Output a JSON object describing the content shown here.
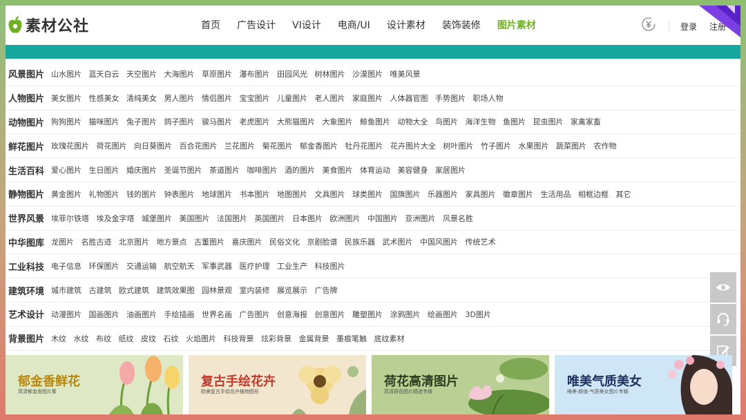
{
  "header": {
    "logo_text": "素材公社",
    "nav": [
      {
        "label": "首页",
        "active": false
      },
      {
        "label": "广告设计",
        "active": false
      },
      {
        "label": "VI设计",
        "active": false
      },
      {
        "label": "电商/UI",
        "active": false
      },
      {
        "label": "设计素材",
        "active": false
      },
      {
        "label": "装饰装修",
        "active": false
      },
      {
        "label": "图片素材",
        "active": true
      }
    ],
    "login": "登录",
    "register": "注册"
  },
  "colors": {
    "accent_green": "#6fb022",
    "teal": "#16a89e"
  },
  "categories": [
    {
      "title": "风景图片",
      "items": [
        "山水图片",
        "蓝天白云",
        "天空图片",
        "大海图片",
        "草原图片",
        "瀑布图片",
        "田园风光",
        "树林图片",
        "沙漠图片",
        "唯美风景"
      ]
    },
    {
      "title": "人物图片",
      "items": [
        "美女图片",
        "性感美女",
        "清纯美女",
        "男人图片",
        "情侣图片",
        "宝宝图片",
        "儿童图片",
        "老人图片",
        "家庭图片",
        "人体器官图",
        "手势图片",
        "职场人物"
      ]
    },
    {
      "title": "动物图片",
      "items": [
        "狗狗图片",
        "猫咪图片",
        "兔子图片",
        "鸽子图片",
        "骏马图片",
        "老虎图片",
        "大熊猫图片",
        "大象图片",
        "鲸鱼图片",
        "动物大全",
        "鸟图片",
        "海洋生物",
        "鱼图片",
        "昆虫图片",
        "家禽家畜"
      ]
    },
    {
      "title": "鲜花图片",
      "items": [
        "玫瑰花图片",
        "荷花图片",
        "向日葵图片",
        "百合花图片",
        "兰花图片",
        "菊花图片",
        "郁金香图片",
        "牡丹花图片",
        "花卉图片大全",
        "树叶图片",
        "竹子图片",
        "水果图片",
        "蔬菜图片",
        "农作物"
      ]
    },
    {
      "title": "生活百科",
      "items": [
        "爱心图片",
        "生日图片",
        "婚庆图片",
        "圣诞节图片",
        "茶道图片",
        "咖啡图片",
        "酒的图片",
        "美食图片",
        "体育运动",
        "美容健身",
        "家居图片"
      ]
    },
    {
      "title": "静物图片",
      "items": [
        "黄金图片",
        "礼物图片",
        "钱的图片",
        "钟表图片",
        "地球图片",
        "书本图片",
        "地图图片",
        "文具图片",
        "球类图片",
        "国旗图片",
        "乐器图片",
        "家具图片",
        "徽章图片",
        "生活用品",
        "相框边框",
        "其它"
      ]
    },
    {
      "title": "世界风景",
      "items": [
        "埃菲尔铁塔",
        "埃及金字塔",
        "城堡图片",
        "美国图片",
        "法国图片",
        "英国图片",
        "日本图片",
        "欧洲图片",
        "中国图片",
        "亚洲图片",
        "风景名胜"
      ]
    },
    {
      "title": "中华图库",
      "items": [
        "龙图片",
        "名胜古迹",
        "北京图片",
        "地方景点",
        "古董图片",
        "喜庆图片",
        "民俗文化",
        "京剧脸谱",
        "民族乐器",
        "武术图片",
        "中国风图片",
        "传统艺术"
      ]
    },
    {
      "title": "工业科技",
      "items": [
        "电子信息",
        "环保图片",
        "交通运输",
        "航空航天",
        "军事武器",
        "医疗护理",
        "工业生产",
        "科技图片"
      ]
    },
    {
      "title": "建筑环境",
      "items": [
        "城市建筑",
        "古建筑",
        "欧式建筑",
        "建筑效果图",
        "园林景观",
        "室内装修",
        "展览展示",
        "广告牌"
      ]
    },
    {
      "title": "艺术设计",
      "items": [
        "动漫图片",
        "国画图片",
        "油画图片",
        "手绘插画",
        "世界名画",
        "广告图片",
        "创意海报",
        "创意图片",
        "雕塑图片",
        "涂鸦图片",
        "绘画图片",
        "3D图片"
      ]
    },
    {
      "title": "背景图片",
      "items": [
        "木纹",
        "水纹",
        "布纹",
        "纸纹",
        "皮纹",
        "石纹",
        "火焰图片",
        "科技背景",
        "炫彩背景",
        "金属背景",
        "墨痕笔触",
        "底纹素材"
      ]
    }
  ],
  "side_tools": [
    {
      "icon": "eye-icon"
    },
    {
      "icon": "headset-icon"
    },
    {
      "icon": "edit-icon"
    }
  ],
  "banners": [
    {
      "title": "郁金香鲜花",
      "subtitle": "高清郁金香图片集",
      "title_color": "#b8860b",
      "bg": "#dfe8c4"
    },
    {
      "title": "复古手绘花卉",
      "subtitle": "欧美复古手绘花卉植物图形",
      "title_color": "#c0392b",
      "bg": "#f3e6cf"
    },
    {
      "title": "荷花高清图片",
      "subtitle": "高清荷花图片精选专辑",
      "title_color": "#2c3e1f",
      "bg": "#b9cf93"
    },
    {
      "title": "唯美气质美女",
      "subtitle": "唯美·颜值·气质美女图片专辑",
      "title_color": "#1c2f5e",
      "bg": "#cfe6f7"
    }
  ]
}
